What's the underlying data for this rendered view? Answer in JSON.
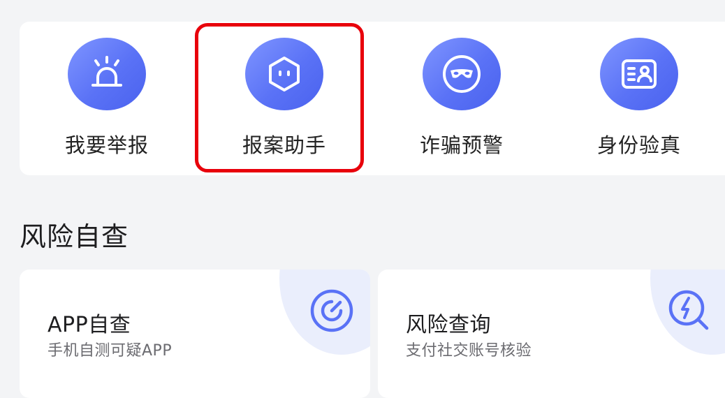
{
  "quick_actions": [
    {
      "label": "我要举报",
      "icon": "alarm-siren-icon"
    },
    {
      "label": "报案助手",
      "icon": "robot-hexagon-icon"
    },
    {
      "label": "诈骗预警",
      "icon": "masked-face-icon"
    },
    {
      "label": "身份验真",
      "icon": "id-card-icon"
    }
  ],
  "highlighted_action": "报案助手",
  "highlight_color": "#e8000b",
  "accent_color": "#5a72f6",
  "section": {
    "title": "风险自查"
  },
  "cards": [
    {
      "title": "APP自查",
      "subtitle": "手机自测可疑APP",
      "icon": "target-scan-icon"
    },
    {
      "title": "风险查询",
      "subtitle": "支付社交账号核验",
      "icon": "lightning-search-icon"
    }
  ]
}
